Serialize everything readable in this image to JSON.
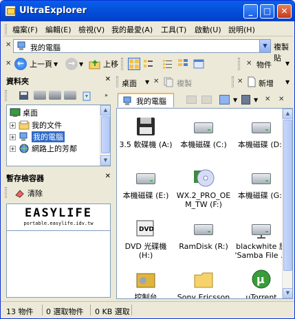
{
  "window": {
    "title": "UltraExplorer"
  },
  "menu": [
    "檔案(F)",
    "編輯(E)",
    "檢視(V)",
    "我的最愛(A)",
    "工具(T)",
    "啟動(U)",
    "說明(H)"
  ],
  "address": {
    "value": "我的電腦",
    "copy_label": "複製貼"
  },
  "nav": {
    "back_label": "上一頁",
    "up_label": "上移",
    "objects_label": "物件"
  },
  "left_panel": {
    "title": "資料夾",
    "tree": [
      {
        "label": "桌面",
        "icon": "desktop-icon"
      },
      {
        "label": "我的文件",
        "icon": "folder-icon"
      },
      {
        "label": "我的電腦",
        "icon": "computer-icon",
        "selected": true
      },
      {
        "label": "網路上的芳鄰",
        "icon": "network-icon"
      }
    ]
  },
  "clipboard_panel": {
    "title": "暫存檢容器",
    "clear_label": "清除",
    "logo_main": "EASYLIFE",
    "logo_sub": "portable.easylife.idv.tw"
  },
  "right_panel": {
    "desktop_label": "桌面",
    "copy_label": "複製",
    "new_label": "新增",
    "tab_label": "我的電腦"
  },
  "files": [
    {
      "name": "3.5 軟碟機 (A:)",
      "icon": "floppy-icon"
    },
    {
      "name": "本機磁碟 (C:)",
      "icon": "drive-icon"
    },
    {
      "name": "本機磁碟 (D:)",
      "icon": "drive-icon"
    },
    {
      "name": "本機磁碟 (E:)",
      "icon": "drive-icon"
    },
    {
      "name": "WX.2_PRO_OEM_TW (F:)",
      "icon": "cd-icon"
    },
    {
      "name": "本機磁碟 (G:)",
      "icon": "drive-icon"
    },
    {
      "name": "DVD 光碟機 (H:)",
      "icon": "dvd-icon"
    },
    {
      "name": "RamDisk (R:)",
      "icon": "drive-icon"
    },
    {
      "name": "blackwhite 於 'Samba File ...",
      "icon": "network-drive-icon"
    },
    {
      "name": "控制台",
      "icon": "control-panel-icon"
    },
    {
      "name": "Sony Ericsson ...",
      "icon": "folder-icon"
    },
    {
      "name": "uTorrent",
      "icon": "utorrent-icon"
    }
  ],
  "status": {
    "objects": "13 物件",
    "selected": "0 選取物件",
    "size": "0 KB 選取"
  }
}
